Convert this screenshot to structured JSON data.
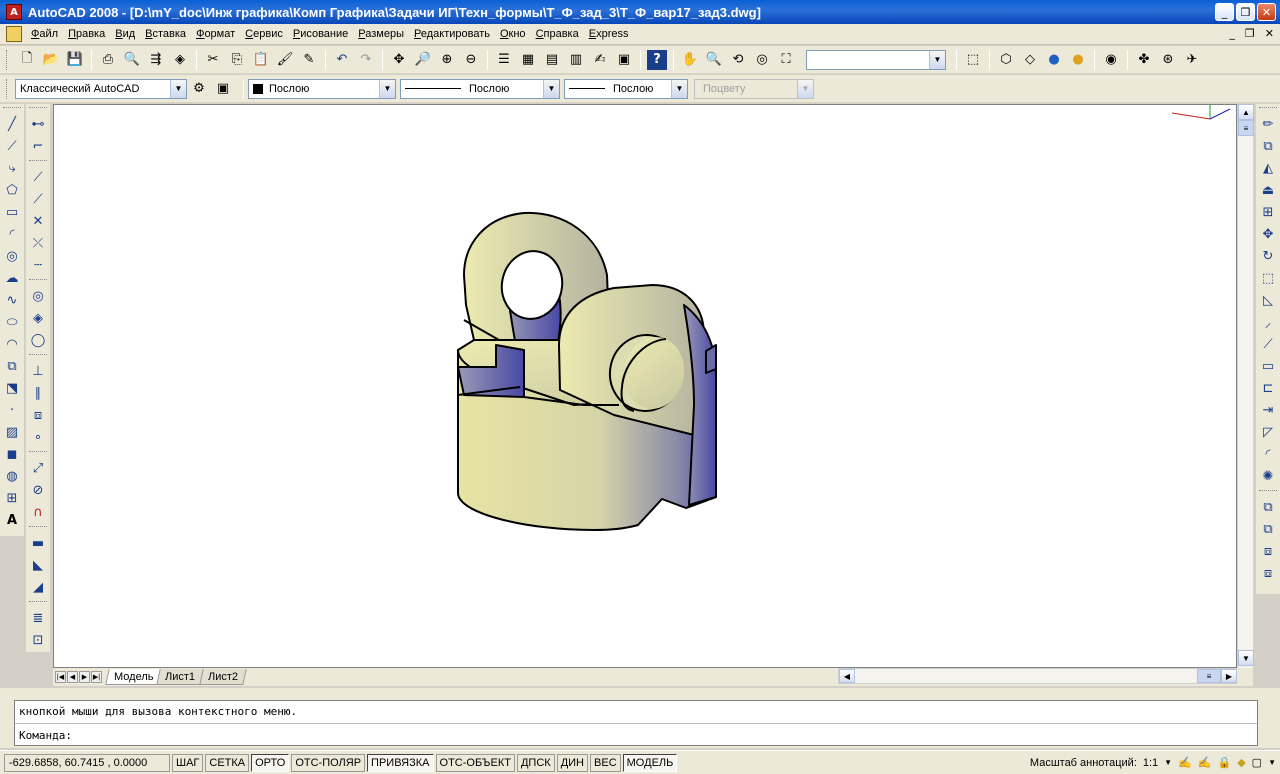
{
  "window": {
    "app_icon": "A",
    "title": "AutoCAD 2008 - [D:\\mY_doc\\Инж графика\\Комп Графика\\Задачи ИГ\\Техн_формы\\Т_Ф_зад_3\\Т_Ф_вар17_зад3.dwg]",
    "buttons": [
      "_",
      "❐",
      "✕"
    ],
    "doc_buttons": [
      "_",
      "❐",
      "✕"
    ]
  },
  "menu": [
    "Файл",
    "Правка",
    "Вид",
    "Вставка",
    "Формат",
    "Сервис",
    "Рисование",
    "Размеры",
    "Редактировать",
    "Окно",
    "Справка",
    "Express"
  ],
  "toolbar1": {
    "icons": [
      "new-icon",
      "open-icon",
      "save-icon",
      "plot-icon",
      "plot-preview-icon",
      "publish-icon",
      "3dprint-icon",
      "cut-icon",
      "copy-icon",
      "paste-icon",
      "match-properties-icon",
      "block-editor-icon",
      "undo-icon",
      "redo-icon",
      "pan-icon",
      "zoom-realtime-icon",
      "zoom-window-icon",
      "zoom-previous-icon",
      "properties-icon",
      "design-center-icon",
      "tool-palettes-icon",
      "sheet-set-icon",
      "markup-icon",
      "calculator-icon",
      "help-icon"
    ],
    "icons2": [
      "pan-icon",
      "zoom-icon",
      "orbit-icon",
      "view-icon",
      "camera-icon"
    ],
    "combo_value": "",
    "icons3": [
      "ucs-icon",
      "box-icon",
      "shade-icon",
      "render-icon",
      "material-icon",
      "orbit2-icon",
      "walk-icon",
      "fly-icon"
    ]
  },
  "toolbar2": {
    "workspace": "Классический AutoCAD",
    "color": "Послою",
    "linetype": "Послою",
    "lineweight": "Послою",
    "plotstyle": "Поцвету"
  },
  "tabs": [
    "Модель",
    "Лист1",
    "Лист2"
  ],
  "command": {
    "history": "кнопкой мыши для вызова контекстного меню.",
    "prompt": "Команда:"
  },
  "status": {
    "coords": "-629.6858, 60.7415 , 0.0000",
    "toggles": [
      {
        "label": "ШАГ",
        "on": false
      },
      {
        "label": "СЕТКА",
        "on": false
      },
      {
        "label": "ОРТО",
        "on": true
      },
      {
        "label": "ОТС-ПОЛЯР",
        "on": false
      },
      {
        "label": "ПРИВЯЗКА",
        "on": true
      },
      {
        "label": "ОТС-ОБЪЕКТ",
        "on": false
      },
      {
        "label": "ДПСК",
        "on": false
      },
      {
        "label": "ДИН",
        "on": false
      },
      {
        "label": "ВЕС",
        "on": false
      },
      {
        "label": "МОДЕЛЬ",
        "on": true
      }
    ],
    "annotation_scale_label": "Масштаб аннотаций:",
    "annotation_scale": "1:1"
  },
  "colors": {
    "title_bar": "#0a5fd6",
    "model_yellow": "#e8e6a4",
    "model_blue": "#5a5aa8"
  }
}
